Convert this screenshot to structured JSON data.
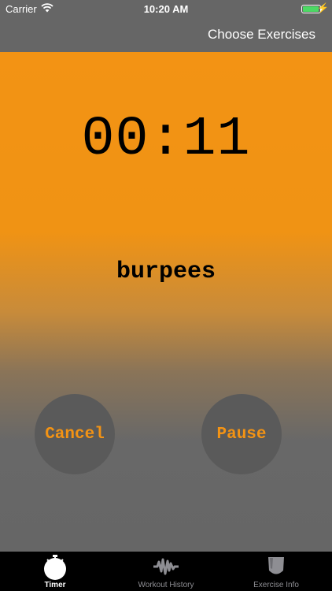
{
  "status_bar": {
    "carrier": "Carrier",
    "time": "10:20 AM",
    "battery_color": "#4cd964"
  },
  "nav": {
    "right_button": "Choose Exercises"
  },
  "timer": {
    "display": "00:11",
    "exercise": "burpees"
  },
  "buttons": {
    "cancel": "Cancel",
    "pause": "Pause"
  },
  "tabs": [
    {
      "label": "Timer",
      "icon": "stopwatch-icon",
      "active": true
    },
    {
      "label": "Workout History",
      "icon": "waveform-icon",
      "active": false
    },
    {
      "label": "Exercise Info",
      "icon": "shield-icon",
      "active": false
    }
  ],
  "colors": {
    "accent": "#f39314",
    "nav_background": "#666666",
    "button_background": "#5a5a5a"
  }
}
